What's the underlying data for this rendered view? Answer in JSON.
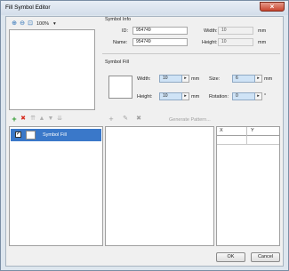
{
  "window": {
    "title": "Fill Symbol Editor",
    "close_glyph": "×"
  },
  "preview": {
    "zoom_in_icon": "⊕",
    "zoom_out_icon": "⊖",
    "fit_icon": "⊡",
    "zoom_value": "100%",
    "zoom_arrow": "▾"
  },
  "symbol_info": {
    "title": "Symbol Info",
    "id_label": "ID:",
    "id_value": "954749",
    "name_label": "Name:",
    "name_value": "954749",
    "width_label": "Width:",
    "width_value": "10",
    "width_unit": "mm",
    "height_label": "Height:",
    "height_value": "10",
    "height_unit": "mm"
  },
  "symbol_fill": {
    "title": "Symbol Fill",
    "width_label": "Width:",
    "width_value": "10",
    "width_unit": "mm",
    "height_label": "Height:",
    "height_value": "10",
    "height_unit": "mm",
    "size_label": "Size:",
    "size_value": "6",
    "size_unit": "mm",
    "rotation_label": "Rotation:",
    "rotation_value": "0",
    "rotation_unit": "°",
    "spin_glyph": "▸"
  },
  "layers": {
    "add_icon": "+",
    "delete_icon": "✖",
    "up_icon": "▲",
    "down_icon": "▼",
    "item_label": "Symbol Fill"
  },
  "pattern": {
    "add_icon": "+",
    "edit_icon": "✎",
    "delete_icon": "✖",
    "generate_label": "Generate Pattern...",
    "columns": [
      "X",
      "Y"
    ]
  },
  "buttons": {
    "ok": "OK",
    "cancel": "Cancel"
  }
}
